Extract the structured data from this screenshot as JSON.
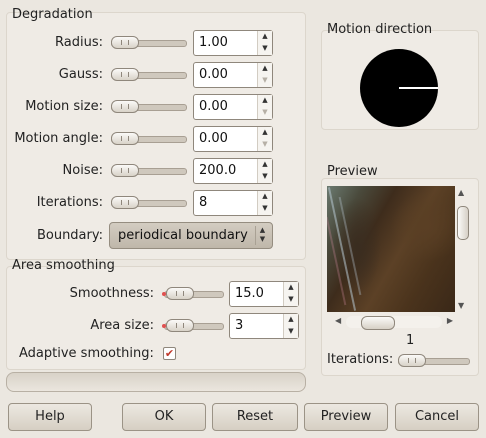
{
  "degradation": {
    "title": "Degradation",
    "radius": {
      "label": "Radius:",
      "value": "1.00",
      "slider_fraction": 0.0
    },
    "gauss": {
      "label": "Gauss:",
      "value": "0.00",
      "slider_fraction": 0.0
    },
    "motion_size": {
      "label": "Motion size:",
      "value": "0.00",
      "slider_fraction": 0.0
    },
    "motion_angle": {
      "label": "Motion angle:",
      "value": "0.00",
      "slider_fraction": 0.0
    },
    "noise": {
      "label": "Noise:",
      "value": "200.0",
      "slider_fraction": 0.0
    },
    "iterations": {
      "label": "Iterations:",
      "value": "8",
      "slider_fraction": 0.0
    },
    "boundary": {
      "label": "Boundary:",
      "value": "periodical boundary"
    }
  },
  "area_smoothing": {
    "title": "Area smoothing",
    "smoothness": {
      "label": "Smoothness:",
      "value": "15.0",
      "slider_fraction": 0.0
    },
    "area_size": {
      "label": "Area size:",
      "value": "3",
      "slider_fraction": 0.0
    },
    "adaptive": {
      "label": "Adaptive smoothing:",
      "checked": true
    }
  },
  "motion_direction": {
    "title": "Motion direction"
  },
  "preview": {
    "title": "Preview",
    "page_number": "1",
    "iterations_label": "Iterations:"
  },
  "buttons": {
    "help": "Help",
    "ok": "OK",
    "reset": "Reset",
    "preview": "Preview",
    "cancel": "Cancel"
  },
  "colors": {
    "window_bg": "#ebe7e0",
    "checkbox_mark": "#c0392b"
  },
  "icons": {
    "spin_up": "▲",
    "spin_down": "▼",
    "checkmark": "✔",
    "combo_arrows": "▲▼",
    "scroll_up": "▲",
    "scroll_down": "▼",
    "scroll_left": "◀",
    "scroll_right": "▶"
  }
}
